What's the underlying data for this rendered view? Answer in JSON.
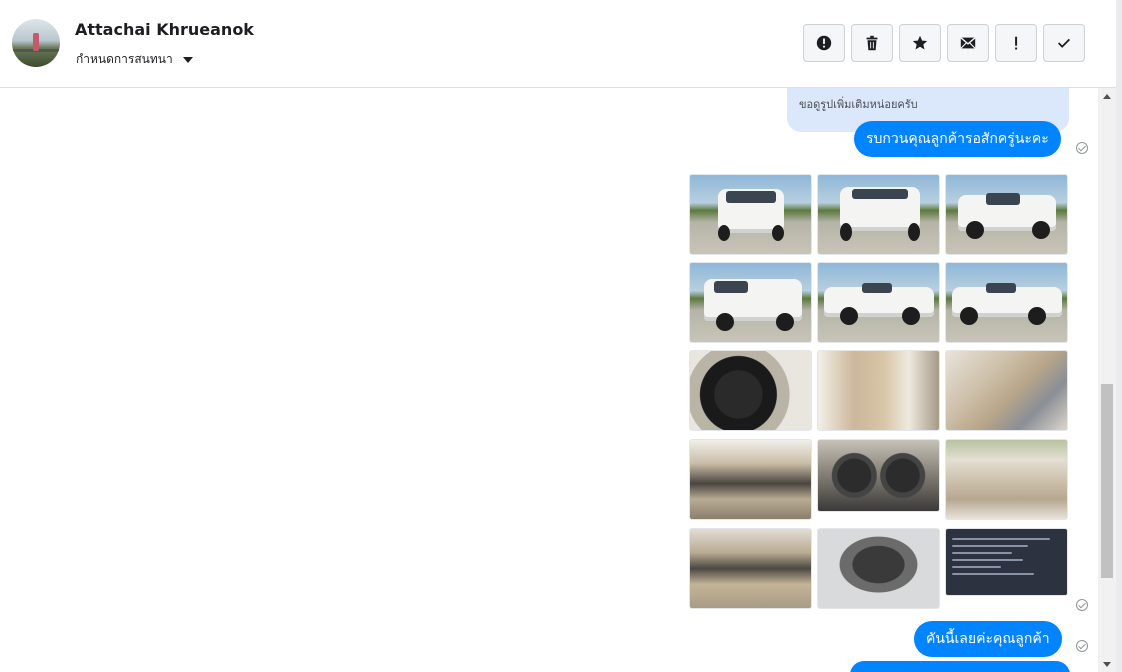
{
  "header": {
    "contact_name": "Attachai Khrueanok",
    "assign_label": "กำหนดการสนทนา",
    "toolbar": [
      {
        "icon": "alert-circle-icon",
        "name": "mark-spam-button"
      },
      {
        "icon": "trash-icon",
        "name": "delete-button"
      },
      {
        "icon": "star-icon",
        "name": "star-button"
      },
      {
        "icon": "envelope-icon",
        "name": "mark-unread-button"
      },
      {
        "icon": "exclamation-icon",
        "name": "follow-up-button"
      },
      {
        "icon": "check-icon",
        "name": "mark-done-button"
      }
    ]
  },
  "messages": {
    "reply_quote": "ขอดูรูปเพิ่มเติมหน่อยครับ",
    "bubble_1": "รบกวนคุณลูกค้ารอสักครู่นะคะ",
    "bubble_2": "คันนี้เลยค่ะคุณลูกค้า",
    "photos": [
      "car-front-photo",
      "car-rear-photo",
      "car-front-side-photo",
      "car-rear-side-photo",
      "car-side-photo",
      "car-side-2-photo",
      "wheel-photo",
      "door-panel-photo",
      "front-seats-photo",
      "dashboard-photo",
      "gauge-cluster-photo",
      "rear-seats-photo",
      "cabin-photo",
      "engine-photo",
      "document-screenshot-photo"
    ]
  },
  "colors": {
    "bubble_blue": "#0084ff",
    "reply_bg": "#dbe7fb"
  }
}
